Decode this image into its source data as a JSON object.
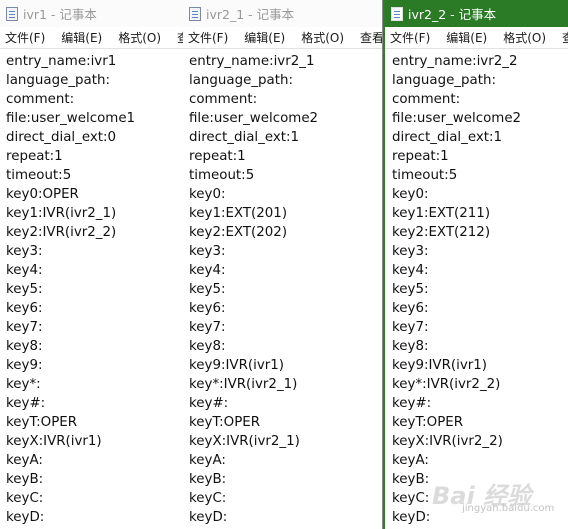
{
  "menu_labels": [
    "文件(F)",
    "编辑(E)",
    "格式(O)",
    "查看(V)"
  ],
  "windows": [
    {
      "title": "ivr1 - 记事本",
      "menu_last": "查看",
      "lines": [
        "entry_name:ivr1",
        "language_path:",
        "comment:",
        "file:user_welcome1",
        "direct_dial_ext:0",
        "repeat:1",
        "timeout:5",
        "key0:OPER",
        "key1:IVR(ivr2_1)",
        "key2:IVR(ivr2_2)",
        "key3:",
        "key4:",
        "key5:",
        "key6:",
        "key7:",
        "key8:",
        "key9:",
        "key*:",
        "key#:",
        "keyT:OPER",
        "keyX:IVR(ivr1)",
        "keyA:",
        "keyB:",
        "keyC:",
        "keyD:"
      ]
    },
    {
      "title": "ivr2_1 - 记事本",
      "menu_last": "查看(V",
      "lines": [
        "entry_name:ivr2_1",
        "language_path:",
        "comment:",
        "file:user_welcome2",
        "direct_dial_ext:1",
        "repeat:1",
        "timeout:5",
        "key0:",
        "key1:EXT(201)",
        "key2:EXT(202)",
        "key3:",
        "key4:",
        "key5:",
        "key6:",
        "key7:",
        "key8:",
        "key9:IVR(ivr1)",
        "key*:IVR(ivr2_1)",
        "key#:",
        "keyT:OPER",
        "keyX:IVR(ivr2_1)",
        "keyA:",
        "keyB:",
        "keyC:",
        "keyD:"
      ]
    },
    {
      "title": "ivr2_2 - 记事本",
      "menu_last": "查看",
      "lines": [
        "entry_name:ivr2_2",
        "language_path:",
        "comment:",
        "file:user_welcome2",
        "direct_dial_ext:1",
        "repeat:1",
        "timeout:5",
        "key0:",
        "key1:EXT(211)",
        "key2:EXT(212)",
        "key3:",
        "key4:",
        "key5:",
        "key6:",
        "key7:",
        "key8:",
        "key9:IVR(ivr1)",
        "key*:IVR(ivr2_2)",
        "key#:",
        "keyT:OPER",
        "keyX:IVR(ivr2_2)",
        "keyA:",
        "keyB:",
        "keyC:",
        "keyD:"
      ]
    }
  ],
  "watermark": {
    "text": "Bai 经验",
    "sub": "jingyan.baidu.com"
  }
}
